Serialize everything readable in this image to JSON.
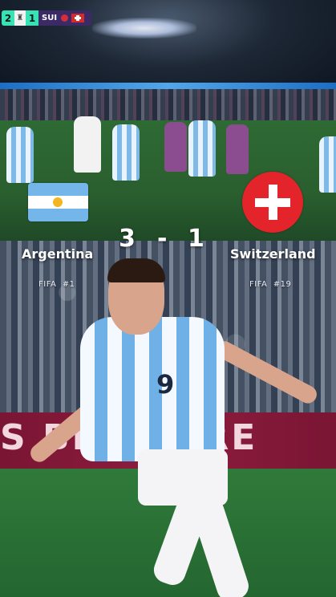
{
  "scorebug": {
    "home_score": "2",
    "away_score": "1",
    "away_team": "SUI",
    "accent_color": "#37e3b5"
  },
  "match": {
    "home_team": "Argentina",
    "away_team": "Switzerland",
    "home_score": "3",
    "separator": "-",
    "away_score": "1",
    "home_rank": "FIFA  #1",
    "away_rank": "FIFA  #19"
  },
  "banner": {
    "text": "S BESI    AIRE"
  },
  "hero": {
    "shirt_number": "9"
  }
}
